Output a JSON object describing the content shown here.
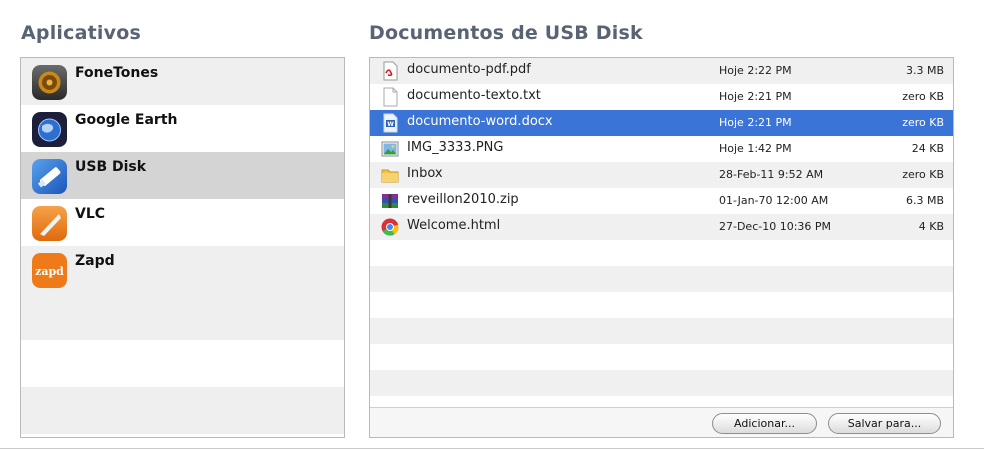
{
  "apps": {
    "title": "Aplicativos",
    "items": [
      {
        "name": "FoneTones",
        "icon": "speaker-icon",
        "selected": false
      },
      {
        "name": "Google Earth",
        "icon": "globe-icon",
        "selected": false
      },
      {
        "name": "USB Disk",
        "icon": "usb-disk-icon",
        "selected": true
      },
      {
        "name": "VLC",
        "icon": "vlc-cone-icon",
        "selected": false
      },
      {
        "name": "Zapd",
        "icon": "zapd-icon",
        "selected": false
      }
    ],
    "zapd_logo_text": "zapd"
  },
  "documents": {
    "title": "Documentos de USB Disk",
    "files": [
      {
        "name": "documento-pdf.pdf",
        "date": "Hoje 2:22 PM",
        "size": "3.3 MB",
        "icon": "pdf-file-icon",
        "selected": false
      },
      {
        "name": "documento-texto.txt",
        "date": "Hoje 2:21 PM",
        "size": "zero KB",
        "icon": "text-file-icon",
        "selected": false
      },
      {
        "name": "documento-word.docx",
        "date": "Hoje 2:21 PM",
        "size": "zero KB",
        "icon": "word-file-icon",
        "selected": true
      },
      {
        "name": "IMG_3333.PNG",
        "date": "Hoje 1:42 PM",
        "size": "24 KB",
        "icon": "image-file-icon",
        "selected": false
      },
      {
        "name": "Inbox",
        "date": "28-Feb-11 9:52 AM",
        "size": "zero KB",
        "icon": "folder-icon",
        "selected": false
      },
      {
        "name": "reveillon2010.zip",
        "date": "01-Jan-70 12:00 AM",
        "size": "6.3 MB",
        "icon": "archive-file-icon",
        "selected": false
      },
      {
        "name": "Welcome.html",
        "date": "27-Dec-10 10:36 PM",
        "size": "4 KB",
        "icon": "chrome-html-icon",
        "selected": false
      }
    ],
    "buttons": {
      "add": "Adicionar...",
      "save": "Salvar para..."
    }
  },
  "colors": {
    "selection": "#3a74d6",
    "app_selection": "#d4d4d4",
    "title": "#5a6373"
  }
}
